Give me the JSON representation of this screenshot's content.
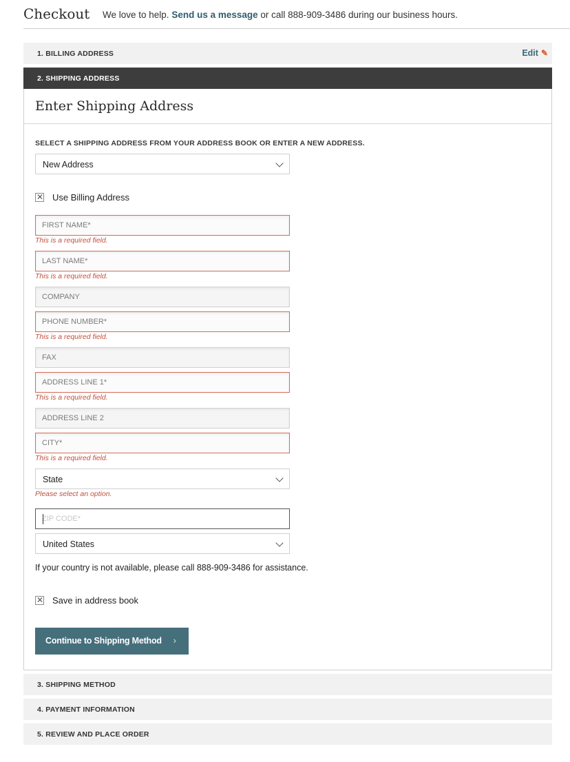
{
  "header": {
    "title": "Checkout",
    "intro_before": "We love to help. ",
    "intro_link": "Send us a message",
    "intro_after": " or call 888-909-3486 during our business hours."
  },
  "steps": [
    {
      "label": "1. BILLING ADDRESS",
      "edit_label": "Edit"
    },
    {
      "label": "2. SHIPPING ADDRESS"
    },
    {
      "label": "3. SHIPPING METHOD"
    },
    {
      "label": "4. PAYMENT INFORMATION"
    },
    {
      "label": "5. REVIEW AND PLACE ORDER"
    }
  ],
  "shipping": {
    "heading": "Enter Shipping Address",
    "instruction": "SELECT A SHIPPING ADDRESS FROM YOUR ADDRESS BOOK OR ENTER A NEW ADDRESS.",
    "address_select": "New Address",
    "use_billing_label": "Use Billing Address",
    "fields": {
      "first_name": "FIRST NAME*",
      "last_name": "LAST NAME*",
      "company": "COMPANY",
      "phone": "PHONE NUMBER*",
      "fax": "FAX",
      "address1": "ADDRESS LINE 1*",
      "address2": "ADDRESS LINE 2",
      "city": "CITY*",
      "zip": "ZIP CODE*"
    },
    "required_error": "This is a required field.",
    "state_select": "State",
    "state_error": "Please select an option.",
    "country_select": "United States",
    "country_note": "If your country is not available, please call 888-909-3486 for assistance.",
    "save_label": "Save in address book",
    "continue_label": "Continue to Shipping Method"
  },
  "colors": {
    "active_step": "#3d3d3d",
    "button": "#466f7c",
    "error": "#c0503c",
    "link": "#2f5d6e",
    "edit_pencil": "#e0572a"
  }
}
